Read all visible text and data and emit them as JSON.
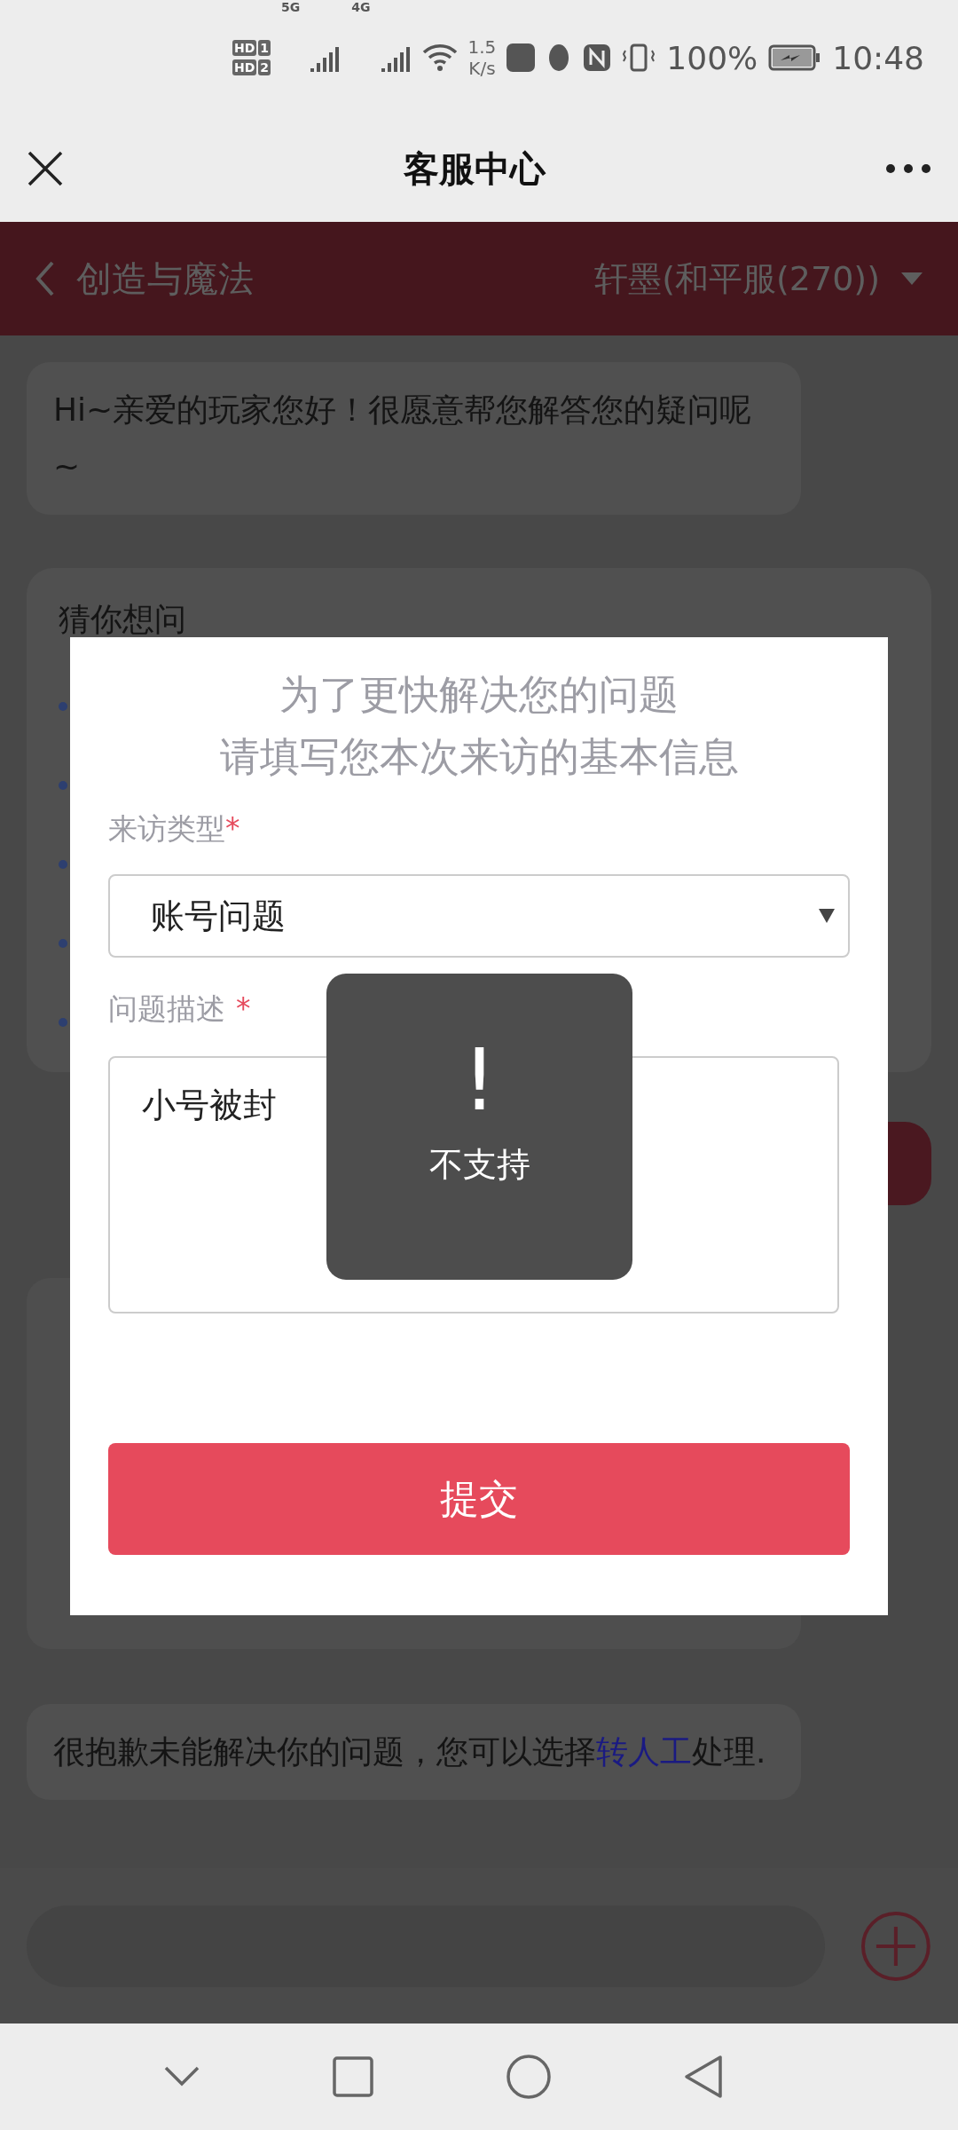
{
  "status_bar": {
    "sim_badges": [
      {
        "label": "HD",
        "slot": "1"
      },
      {
        "label": "HD",
        "slot": "2"
      }
    ],
    "networks": [
      "5G",
      "4G"
    ],
    "speed_value": "1.5",
    "speed_unit": "K/s",
    "battery": "100%",
    "time": "10:48"
  },
  "header": {
    "title": "客服中心"
  },
  "game_bar": {
    "game": "创造与魔法",
    "server": "轩墨(和平服(270))"
  },
  "messages": [
    {
      "kind": "text",
      "text": "Hi~亲爱的玩家您好！很愿意帮您解答您的疑问呢~"
    },
    {
      "kind": "faq",
      "title": "猜你想问"
    },
    {
      "kind": "action"
    },
    {
      "kind": "card"
    },
    {
      "kind": "link_text",
      "before": "很抱歉未能解决你的问题，您可以选择",
      "link": "转人工",
      "after": "处理."
    }
  ],
  "modal": {
    "title_lines": [
      "为了更快解决您的问题",
      "请填写您本次来访的基本信息"
    ],
    "fields": [
      {
        "kind": "select",
        "label": "来访类型",
        "mark": "*",
        "value": "账号问题"
      },
      {
        "kind": "textarea",
        "label": "问题描述",
        "mark": "*",
        "value": "小号被封"
      }
    ],
    "submit": "提交"
  },
  "toast": {
    "icon": "!",
    "message": "不支持"
  }
}
